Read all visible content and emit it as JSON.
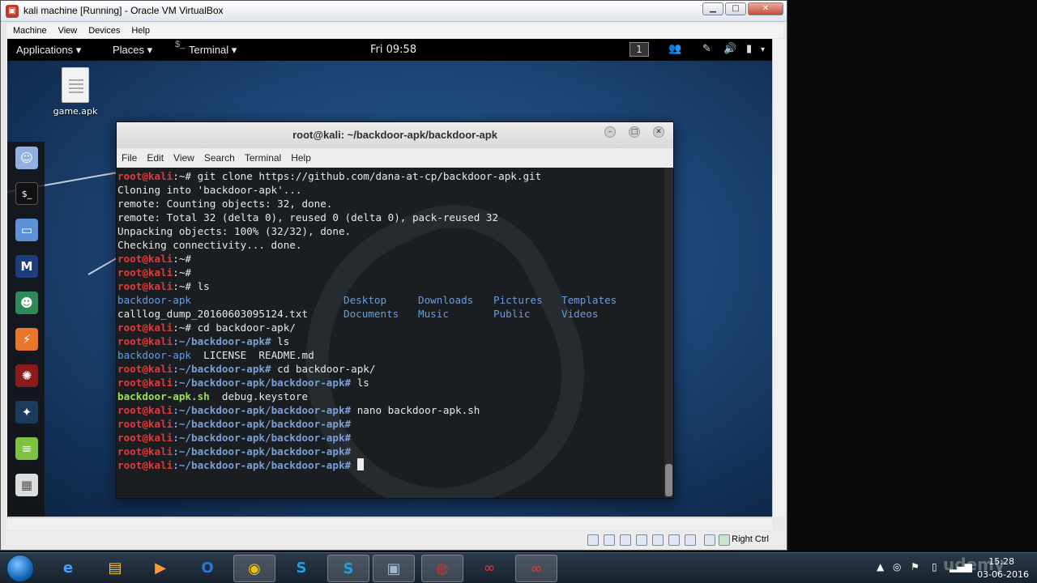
{
  "vbox": {
    "title": "kali machine [Running] - Oracle VM VirtualBox",
    "menu": [
      "Machine",
      "View",
      "Devices",
      "Help"
    ],
    "host_key": "Right Ctrl"
  },
  "gnome": {
    "applications": "Applications ▾",
    "places": "Places ▾",
    "terminal": "Terminal ▾",
    "clock": "Fri 09:58",
    "workspace": "1"
  },
  "desktop": {
    "icon_label": "game.apk"
  },
  "terminal": {
    "title": "root@kali: ~/backdoor-apk/backdoor-apk",
    "menu": [
      "File",
      "Edit",
      "View",
      "Search",
      "Terminal",
      "Help"
    ],
    "prompt_user": "root@kali",
    "paths": {
      "home": ":~# ",
      "repo": ":~/backdoor-apk# ",
      "inner": ":~/backdoor-apk/backdoor-apk# "
    },
    "commands": {
      "clone": "git clone https://github.com/dana-at-cp/backdoor-apk.git",
      "ls": "ls",
      "cd1": "cd backdoor-apk/",
      "nano": "nano backdoor-apk.sh"
    },
    "output": {
      "cloning": "Cloning into 'backdoor-apk'...",
      "counting": "remote: Counting objects: 32, done.",
      "total": "remote: Total 32 (delta 0), reused 0 (delta 0), pack-reused 32",
      "unpacking": "Unpacking objects: 100% (32/32), done.",
      "checking": "Checking connectivity... done."
    },
    "ls_home": {
      "backdoor": "backdoor-apk",
      "calllog": "calllog_dump_20160603095124.txt",
      "desktop": "Desktop",
      "documents": "Documents",
      "downloads": "Downloads",
      "music": "Music",
      "pictures": "Pictures",
      "public": "Public",
      "templates": "Templates",
      "videos": "Videos"
    },
    "ls_repo": {
      "dir": "backdoor-apk",
      "license": "LICENSE",
      "readme": "README.md"
    },
    "ls_inner": {
      "script": "backdoor-apk.sh",
      "keystore": "debug.keystore"
    }
  },
  "taskbar": {
    "time": "15:28",
    "date": "03-06-2016",
    "watermark": "udemy"
  }
}
